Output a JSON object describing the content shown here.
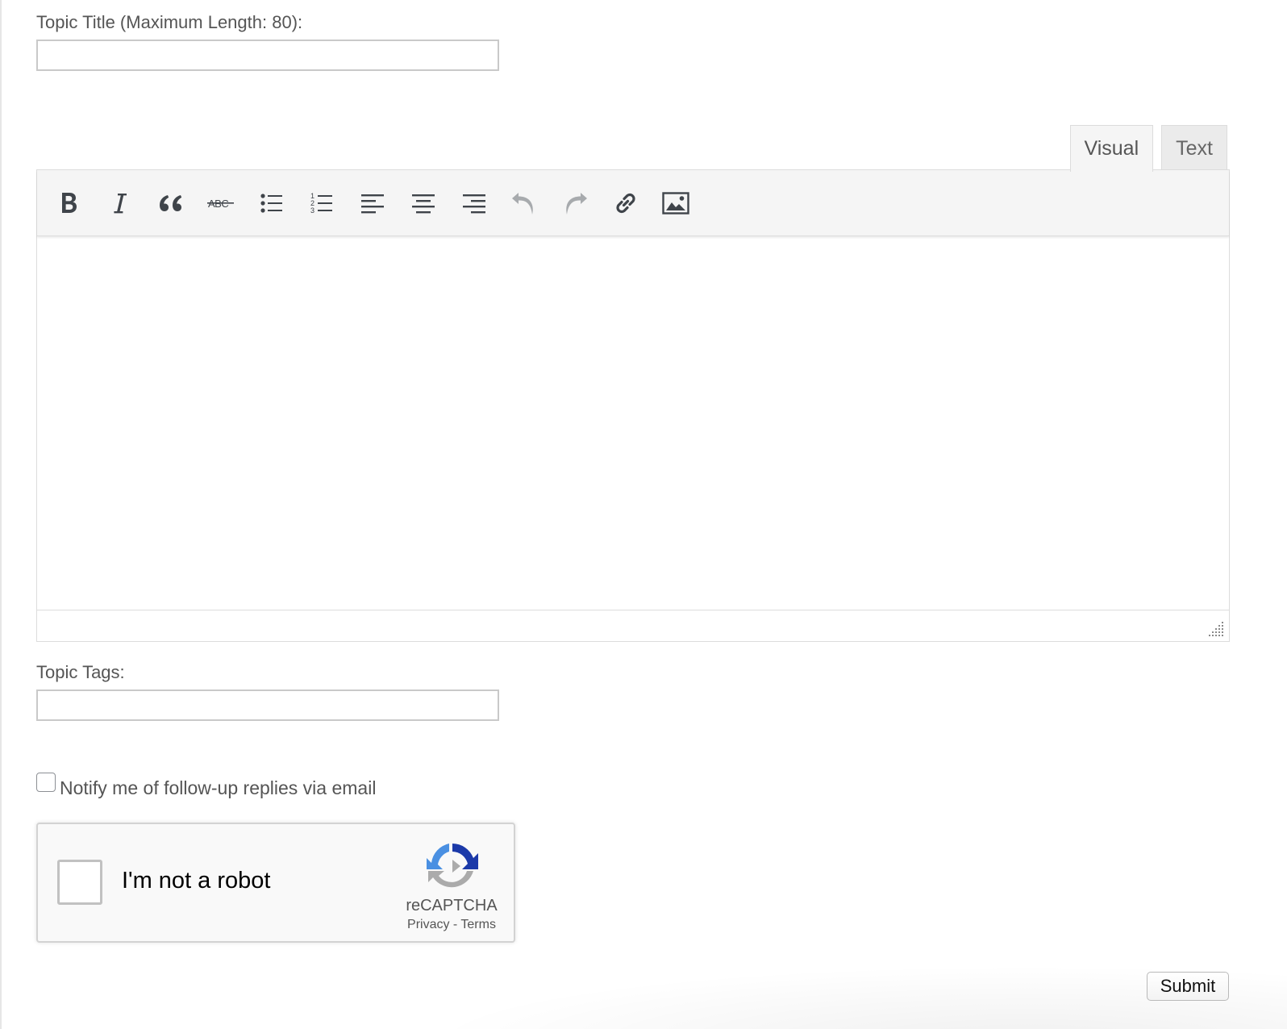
{
  "form": {
    "title_label": "Topic Title (Maximum Length: 80):",
    "title_value": "",
    "tags_label": "Topic Tags:",
    "tags_value": "",
    "notify_label": "Notify me of follow-up replies via email",
    "submit_label": "Submit"
  },
  "editor": {
    "tabs": [
      {
        "label": "Visual",
        "active": true
      },
      {
        "label": "Text",
        "active": false
      }
    ],
    "toolbar": [
      {
        "icon": "bold-icon",
        "state": "enabled"
      },
      {
        "icon": "italic-icon",
        "state": "enabled"
      },
      {
        "icon": "blockquote-icon",
        "state": "enabled"
      },
      {
        "icon": "strikethrough-icon",
        "state": "enabled"
      },
      {
        "icon": "bulleted-list-icon",
        "state": "enabled"
      },
      {
        "icon": "numbered-list-icon",
        "state": "enabled"
      },
      {
        "icon": "align-left-icon",
        "state": "enabled"
      },
      {
        "icon": "align-center-icon",
        "state": "enabled"
      },
      {
        "icon": "align-right-icon",
        "state": "enabled"
      },
      {
        "icon": "undo-icon",
        "state": "disabled"
      },
      {
        "icon": "redo-icon",
        "state": "disabled"
      },
      {
        "icon": "link-icon",
        "state": "enabled"
      },
      {
        "icon": "image-icon",
        "state": "enabled"
      }
    ],
    "content": ""
  },
  "recaptcha": {
    "label": "I'm not a robot",
    "brand": "reCAPTCHA",
    "privacy": "Privacy",
    "separator": " - ",
    "terms": "Terms"
  },
  "colors": {
    "text": "#555555",
    "icon": "#3f444a",
    "icon_disabled": "#a7aaad",
    "toolbar_bg": "#f5f5f5",
    "recaptcha_blue": "#1c3aa9",
    "recaptcha_light_blue": "#4a90e2",
    "recaptcha_gray": "#ababab"
  }
}
